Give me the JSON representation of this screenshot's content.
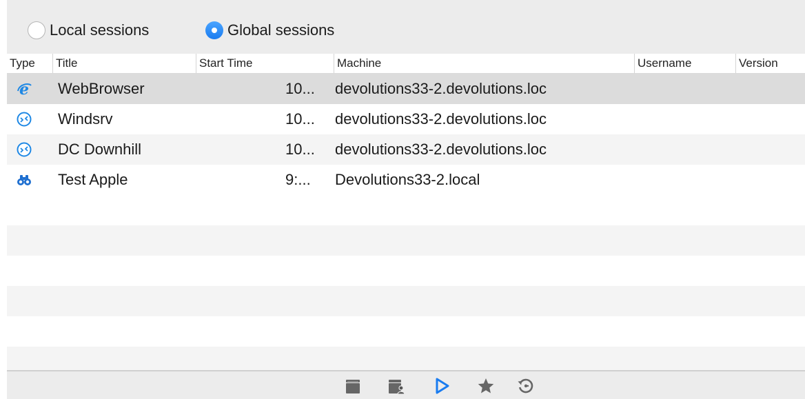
{
  "scope": {
    "local_label": "Local sessions",
    "global_label": "Global sessions",
    "selected": "global"
  },
  "columns": {
    "type": "Type",
    "title": "Title",
    "start_time": "Start Time",
    "machine": "Machine",
    "username": "Username",
    "version": "Version"
  },
  "sessions": [
    {
      "icon": "internet-explorer-icon",
      "title": "WebBrowser",
      "start_time": "10...",
      "machine": "devolutions33-2.devolutions.loc",
      "username": "",
      "version": ""
    },
    {
      "icon": "remote-desktop-icon",
      "title": "Windsrv",
      "start_time": "10...",
      "machine": "devolutions33-2.devolutions.loc",
      "username": "",
      "version": ""
    },
    {
      "icon": "remote-desktop-icon",
      "title": "DC Downhill",
      "start_time": "10...",
      "machine": "devolutions33-2.devolutions.loc",
      "username": "",
      "version": ""
    },
    {
      "icon": "binoculars-icon",
      "title": "Test Apple",
      "start_time": "9:...",
      "machine": "Devolutions33-2.local",
      "username": "",
      "version": ""
    }
  ],
  "footer_icons": [
    "open-session-icon",
    "open-session-user-icon",
    "play-icon",
    "star-icon",
    "history-icon"
  ],
  "colors": {
    "accent": "#1a7cf0",
    "selected_row": "#dcdcdc",
    "alt_row": "#f4f4f4",
    "toolbar": "#ececec"
  }
}
